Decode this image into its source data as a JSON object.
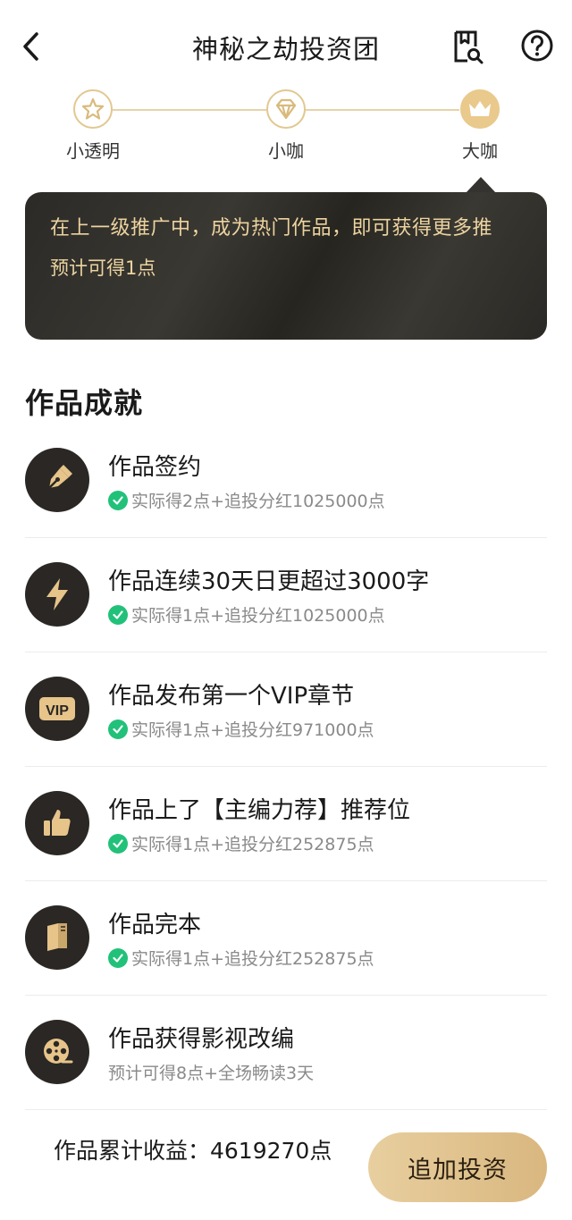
{
  "header": {
    "title": "神秘之劫投资团"
  },
  "levels": [
    {
      "label": "小透明",
      "icon": "star-icon"
    },
    {
      "label": "小咖",
      "icon": "diamond-icon"
    },
    {
      "label": "大咖",
      "icon": "crown-icon"
    }
  ],
  "tip": {
    "text": "在上一级推广中，成为热门作品，即可获得更多推",
    "sub": "预计可得1点"
  },
  "section_title": "作品成就",
  "achievements": [
    {
      "name": "作品签约",
      "desc": "实际得2点+追投分红1025000点",
      "done": true,
      "icon": "pen-icon"
    },
    {
      "name": "作品连续30天日更超过3000字",
      "desc": "实际得1点+追投分红1025000点",
      "done": true,
      "icon": "lightning-icon"
    },
    {
      "name": "作品发布第一个VIP章节",
      "desc": "实际得1点+追投分红971000点",
      "done": true,
      "icon": "vip-icon",
      "icon_text": "VIP"
    },
    {
      "name": "作品上了【主编力荐】推荐位",
      "desc": "实际得1点+追投分红252875点",
      "done": true,
      "icon": "thumbs-up-icon"
    },
    {
      "name": "作品完本",
      "desc": "实际得1点+追投分红252875点",
      "done": true,
      "icon": "book-icon"
    },
    {
      "name": "作品获得影视改编",
      "desc": "预计可得8点+全场畅读3天",
      "done": false,
      "icon": "film-reel-icon"
    }
  ],
  "footer": {
    "total": "作品累计收益：4619270点",
    "invest_label": "追加投资"
  },
  "colors": {
    "gold": "#e9c98c",
    "dark": "#2a2724",
    "check": "#22c17a"
  }
}
